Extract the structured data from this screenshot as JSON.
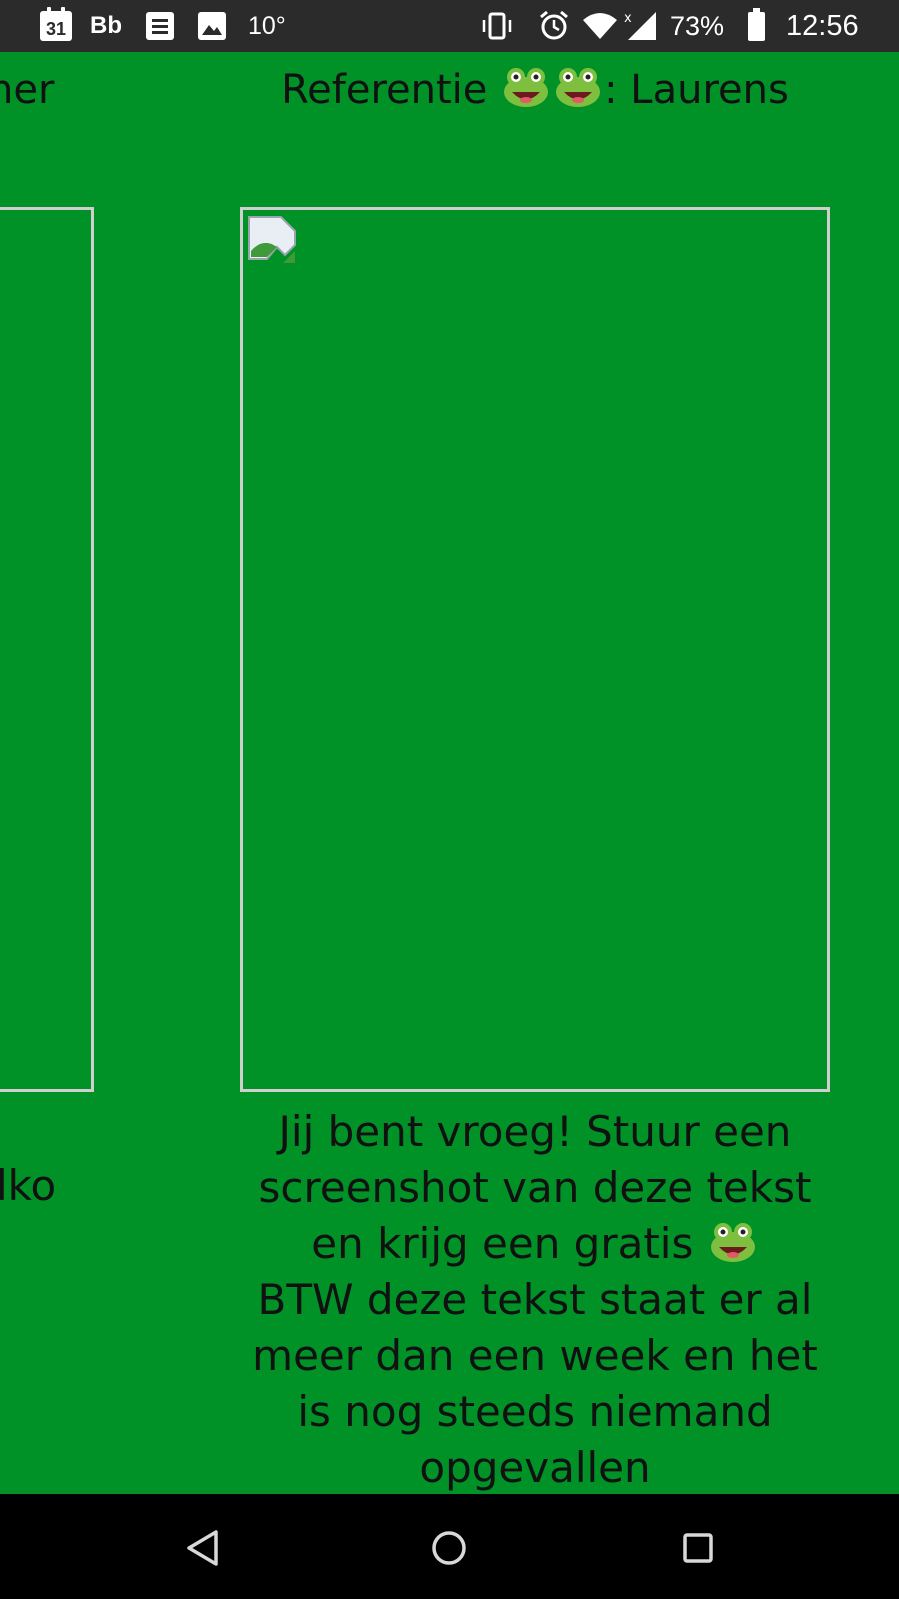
{
  "status_bar": {
    "calendar_day": "31",
    "app_label": "Bb",
    "temperature": "10°",
    "battery_percent": "73%",
    "time": "12:56",
    "icons": [
      "calendar-icon",
      "blackboard-icon",
      "document-icon",
      "image-icon",
      "vibrate-icon",
      "alarm-icon",
      "wifi-icon",
      "signal-icon",
      "battery-icon"
    ]
  },
  "carousel": {
    "prev_slide": {
      "title_fragment": "ner",
      "caption_fragment": "lko"
    },
    "current_slide": {
      "title_prefix": "Referentie",
      "title_suffix": ": Laurens",
      "title_emoji": [
        "frog-emoji",
        "frog-emoji"
      ],
      "image": "broken-image-icon",
      "caption_lines": [
        "Jij bent vroeg! Stuur een",
        "screenshot van deze tekst",
        "en krijg een gratis",
        "BTW deze tekst staat er al",
        "meer dan een week en het",
        "is nog steeds niemand",
        "opgevallen"
      ]
    }
  },
  "nav_bar": {
    "buttons": [
      "back-button",
      "home-button",
      "recents-button"
    ]
  },
  "colors": {
    "background": "#009127",
    "status_bar": "#2b2b2b",
    "nav_bar": "#000000",
    "frame_border": "#cfcfcf",
    "text": "#111111"
  }
}
